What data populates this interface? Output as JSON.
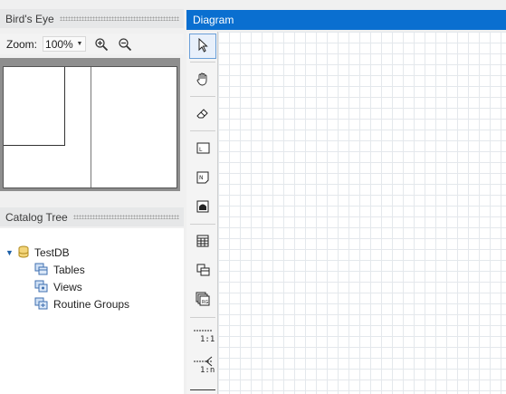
{
  "birds_eye": {
    "title": "Bird's Eye",
    "zoom_label": "Zoom:",
    "zoom_value": "100%"
  },
  "catalog_tree": {
    "title": "Catalog Tree",
    "database": "TestDB",
    "children": [
      "Tables",
      "Views",
      "Routine Groups"
    ]
  },
  "diagram": {
    "title": "Diagram"
  },
  "toolbox": {
    "relation_one_to_one": "1:1",
    "relation_one_to_many": "1:n"
  },
  "colors": {
    "accent": "#0a6fd0",
    "panel_header": "#e6e7e8",
    "grid": "#e4e8ec"
  },
  "icons": {
    "pointer": "cursor-arrow-icon",
    "hand": "hand-pan-icon",
    "eraser": "eraser-icon",
    "layer": "layer-icon",
    "note": "note-icon",
    "image": "image-icon",
    "table": "table-icon",
    "view": "view-icon",
    "routine": "routine-group-icon",
    "zoom_in": "zoom-in-icon",
    "zoom_out": "zoom-out-icon",
    "database": "database-icon",
    "expand": "expand-arrow-icon"
  }
}
